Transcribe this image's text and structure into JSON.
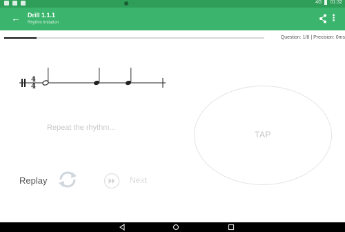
{
  "statusbar": {
    "time": "01:32",
    "signal": "4G"
  },
  "appbar": {
    "title": "Drill 1.1.1",
    "subtitle": "Rhythm Imitation"
  },
  "progress": {
    "fraction": 0.125
  },
  "question_info": "Question: 1/8 | Precision: 0ms",
  "notation": {
    "time_signature_top": "4",
    "time_signature_bottom": "4"
  },
  "prompt": "Repeat the rhythm...",
  "tap_label": "TAP",
  "replay_label": "Replay",
  "next_label": "Next",
  "colors": {
    "status_bar": "#2e9e58",
    "app_bar": "#3bb56d",
    "nav_bar": "#000000"
  }
}
